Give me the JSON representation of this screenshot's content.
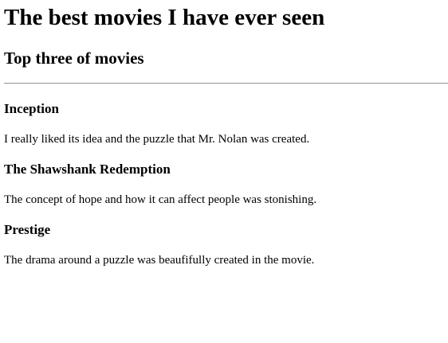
{
  "page": {
    "title": "The best movies I have ever seen",
    "subtitle": "Top three of movies"
  },
  "movies": [
    {
      "name": "Inception",
      "description": "I really liked its idea and the puzzle that Mr. Nolan was created."
    },
    {
      "name": "The Shawshank Redemption",
      "description": "The concept of hope and how it can affect people was stonishing."
    },
    {
      "name": "Prestige",
      "description": "The drama around a puzzle was beaufifully created in the movie."
    }
  ]
}
